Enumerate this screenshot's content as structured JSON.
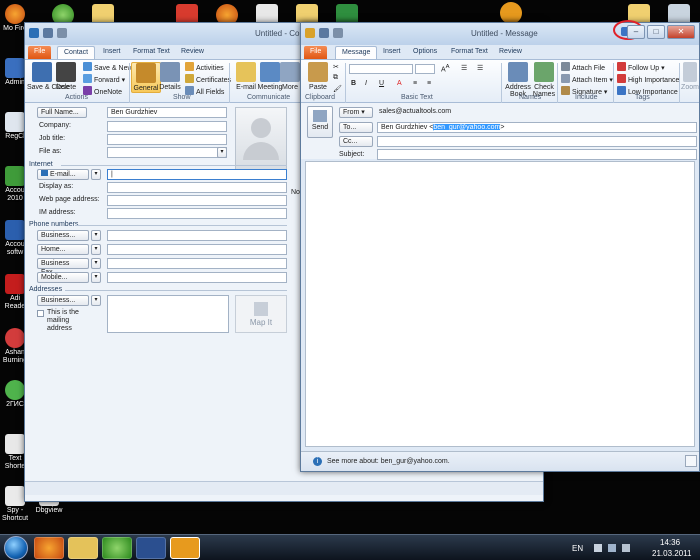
{
  "desktop": {
    "icons": [
      {
        "label": "Mo Fire"
      },
      {
        "label": "Admin"
      },
      {
        "label": "RegCl"
      },
      {
        "label": "Accou 2010"
      },
      {
        "label": "Accou softw"
      },
      {
        "label": "Adi Reade"
      },
      {
        "label": "Ashan Burning"
      },
      {
        "label": "2ГИС"
      },
      {
        "label": "Text Shorte"
      },
      {
        "label": "Spy - Shortcut"
      },
      {
        "label": "Dbgview"
      }
    ]
  },
  "contact_window": {
    "title": "Untitled - Cont",
    "tabs": [
      "File",
      "Contact",
      "Insert",
      "Format Text",
      "Review"
    ],
    "ribbon": {
      "save_close": "Save & Close",
      "delete": "Delete",
      "save_new": "Save & New",
      "forward": "Forward",
      "onenote": "OneNote",
      "general": "General",
      "details": "Details",
      "activities": "Activities",
      "certificates": "Certificates",
      "all_fields": "All Fields",
      "email": "E-mail",
      "meeting": "Meeting",
      "more": "More",
      "groups": {
        "actions": "Actions",
        "show": "Show",
        "communicate": "Communicate"
      }
    },
    "form": {
      "full_name_btn": "Full Name...",
      "full_name_value": "Ben Gurdzhiev",
      "company": "Company:",
      "job_title": "Job title:",
      "file_as": "File as:",
      "internet_section": "Internet",
      "email_btn": "E-mail...",
      "display_as": "Display as:",
      "web_page": "Web page address:",
      "im_address": "IM address:",
      "phone_section": "Phone numbers",
      "business": "Business...",
      "home": "Home...",
      "business_fax": "Business Fax...",
      "mobile": "Mobile...",
      "addresses_section": "Addresses",
      "address_business": "Business...",
      "mailing_checkbox": "This is the mailing address",
      "map_it": "Map It",
      "notes_stub": "No"
    }
  },
  "message_window": {
    "title": "Untitled - Message",
    "tabs": [
      "File",
      "Message",
      "Insert",
      "Options",
      "Format Text",
      "Review"
    ],
    "ribbon": {
      "paste": "Paste",
      "clipboard": "Clipboard",
      "basic_text": "Basic Text",
      "address_book": "Address Book",
      "check_names": "Check Names",
      "names": "Names",
      "attach_file": "Attach File",
      "attach_item": "Attach Item",
      "signature": "Signature",
      "include": "Include",
      "follow_up": "Follow Up",
      "high_importance": "High Importance",
      "low_importance": "Low Importance",
      "tags": "Tags",
      "zoom": "Zoom"
    },
    "send": "Send",
    "from_btn": "From",
    "from_value": "sales@actualtools.com",
    "to_btn": "To...",
    "to_name": "Ben Gurdzhiev <",
    "to_email": "ben_gur@yahoo.com",
    "to_close": ">",
    "cc_btn": "Cc...",
    "subject_label": "Subject:",
    "people_pane": "See more about: ben_gur@yahoo.com."
  },
  "taskbar": {
    "lang": "EN",
    "time": "14:36",
    "date": "21.03.2011"
  }
}
